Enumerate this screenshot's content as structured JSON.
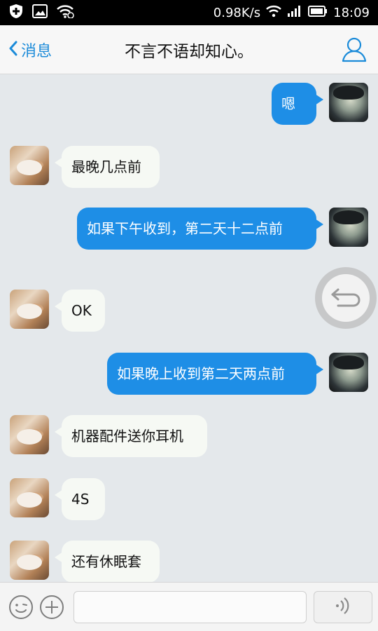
{
  "status_bar": {
    "speed": "0.98K/s",
    "time": "18:09",
    "icons": [
      "shield-plus-icon",
      "image-icon",
      "wifi-icon",
      "wifi-icon",
      "signal-icon",
      "battery-icon"
    ]
  },
  "header": {
    "back_label": "消息",
    "title": "不言不语却知心。",
    "profile_icon": "person-icon"
  },
  "messages": [
    {
      "side": "out",
      "text": "嗯",
      "avatar": "guy"
    },
    {
      "side": "in",
      "text": "最晚几点前",
      "avatar": "cat"
    },
    {
      "side": "out",
      "text": "如果下午收到，第二天十二点前",
      "avatar": "guy"
    },
    {
      "side": "in",
      "text": "OK",
      "avatar": "cat"
    },
    {
      "side": "out",
      "text": "如果晚上收到第二天两点前",
      "avatar": "guy"
    },
    {
      "side": "in",
      "text": "机器配件送你耳机",
      "avatar": "cat"
    },
    {
      "side": "in",
      "text": "4S",
      "avatar": "cat"
    },
    {
      "side": "in",
      "text": "还有休眠套",
      "avatar": "cat"
    }
  ],
  "input_bar": {
    "text_value": "",
    "icons": [
      "emoji-icon",
      "plus-icon",
      "voice-icon"
    ]
  },
  "colors": {
    "accent": "#1b8bd9",
    "outgoing_bubble": "#1e8ee6",
    "incoming_bubble": "#f6f9f4",
    "chat_bg": "#e4e8eb"
  }
}
